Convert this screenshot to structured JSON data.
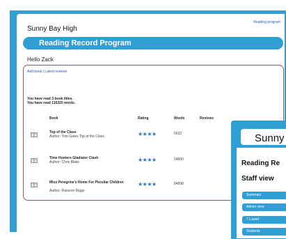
{
  "header": {
    "school_name": "Sunny Bay High",
    "top_link": "Reading program",
    "banner_title": "Reading Record Program",
    "greeting": "Hello Zack"
  },
  "links": {
    "add_book": "Add book",
    "separator": "|",
    "latest_reviews": "Latest reviews"
  },
  "summary": {
    "line1": "You have read 3 book titles.",
    "line2": "You have read 116320 words."
  },
  "table": {
    "columns": [
      "Book",
      "Rating",
      "Words",
      "Reviews"
    ],
    "rows": [
      {
        "title": "Top of the Class",
        "author": "Author: Tom Gates Top of the Class",
        "rating": 4,
        "stars": "★★★★",
        "words": "6632"
      },
      {
        "title": "Time Hunters Gladiator Clash",
        "author": "Author: Chris Blake",
        "rating": 4,
        "stars": "★★★★",
        "words": "24890"
      },
      {
        "title": "Miss Peregrine's Home For Peculiar Children",
        "author": "Author: Ransom Riggs",
        "rating": 4,
        "stars": "★★★★",
        "words": "84898"
      }
    ]
  },
  "staff_panel": {
    "school_name": "Sunny",
    "program_title": "Reading Re",
    "view_title": "Staff view",
    "menu": [
      "Summary",
      "Admin view",
      "7 Laurel",
      "Students"
    ]
  },
  "colors": {
    "brand_blue": "#2f9fd6",
    "star_blue": "#2f73c6",
    "box_border": "#8a5a70"
  }
}
